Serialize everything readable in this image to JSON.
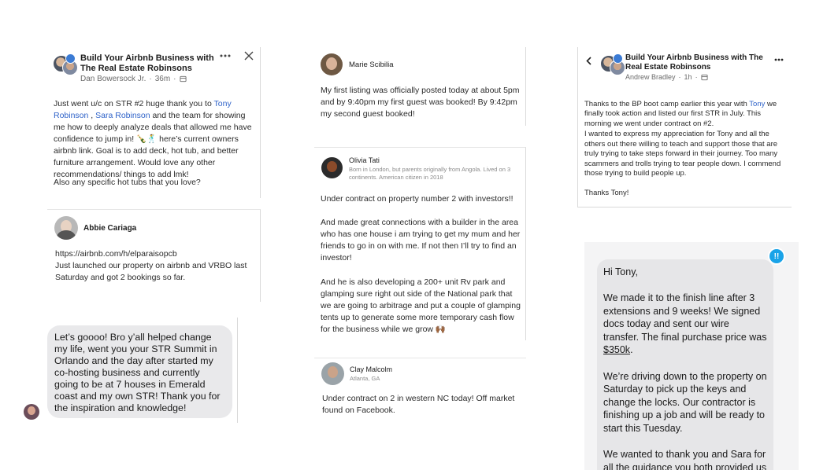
{
  "post1": {
    "group_title": "Build Your Airbnb Business with The Real Estate Robinsons",
    "author": "Dan Bowersock Jr.",
    "time": "36m",
    "text_a": "Just went u/c on STR #2 huge thank you to ",
    "mention1": "Tony Robinson",
    "sep": " , ",
    "mention2": "Sara Robinson",
    "text_b": " and the team for showing me how to deeply analyze deals that allowed me have confidence to jump in! 🍾🕺 here’s current owners airbnb link.  Goal is to add deck, hot tub, and better furniture arrangement. Would love any other recommendations/ things to add lmk!",
    "text_c": "Also any specific hot tubs that you love?"
  },
  "post2": {
    "author": "Abbie Cariaga",
    "link": "https://airbnb.com/h/elparaisopcb",
    "text": "Just launched our property on airbnb and VRBO last Saturday and got 2 bookings so far."
  },
  "bubble1": {
    "text": "Let’s goooo! Bro y’all helped change my life, went you your STR Summit in Orlando and the day after started my co-hosting business and currently going to be at 7 houses in Emerald coast and my own STR! Thank you for the inspiration and knowledge!"
  },
  "post3": {
    "author": "Marie Scibilia",
    "text": "My first listing was officially posted today at about 5pm and by 9:40pm my first guest was booked! By 9:42pm my second guest booked!"
  },
  "post4": {
    "author": "Olivia Tati",
    "bio": "Born in London, but parents originally from Angola. Lived on 3 continents. American citizen in 2018",
    "p1": "Under contract on property number 2 with investors!!",
    "p2": "And made great connections with a builder in the area who has one house i am trying to get my mum and her friends to go in on with me. If not then I’ll try to find an investor!",
    "p3": "And he is also developing a 200+ unit Rv park and glamping sure right out side of the National park that we are going to arbitrage and put a couple of glamping tents up to generate some more temporary cash flow for the business while we grow 🙌🏾"
  },
  "post5": {
    "author": "Clay Malcolm",
    "location": "Atlanta, GA",
    "text": "Under contract on 2 in western NC today! Off market found on Facebook."
  },
  "post6": {
    "group_title": "Build Your Airbnb Business with The Real Estate Robinsons",
    "author": "Andrew Bradley",
    "time": "1h",
    "text_a": "Thanks to the BP boot camp earlier this year with ",
    "mention": "Tony",
    "text_b": " we finally took action and listed our first STR in July. This morning we went under contract on #2.",
    "p2": "I wanted to express my appreciation for Tony and all the others out there willing to teach and support those that are truly trying to take steps forward in their journey. Too many scammers and trolls trying to tear people down. I commend those trying to build people up.",
    "p3": "Thanks Tony!"
  },
  "bubble2": {
    "badge": "!!",
    "greeting": "Hi Tony,",
    "p1a": "We made it to the finish line after 3 extensions and 9 weeks! We signed docs today and sent our wire transfer. The final purchase price was ",
    "price": "$350k",
    "p1b": ".",
    "p2": "We’re driving down to the property on Saturday to pick up the keys and change the locks. Our contractor is finishing up a job and will be ready to start this Tuesday.",
    "p3": "We wanted to thank you and Sara for all the guidance you both provided us"
  },
  "icons": [
    "more-icon",
    "close-icon",
    "back-icon",
    "globe-icon"
  ],
  "colors": {
    "link": "#2f63c9",
    "bubble": "#e9e9eb",
    "badge": "#1aa3e8"
  }
}
